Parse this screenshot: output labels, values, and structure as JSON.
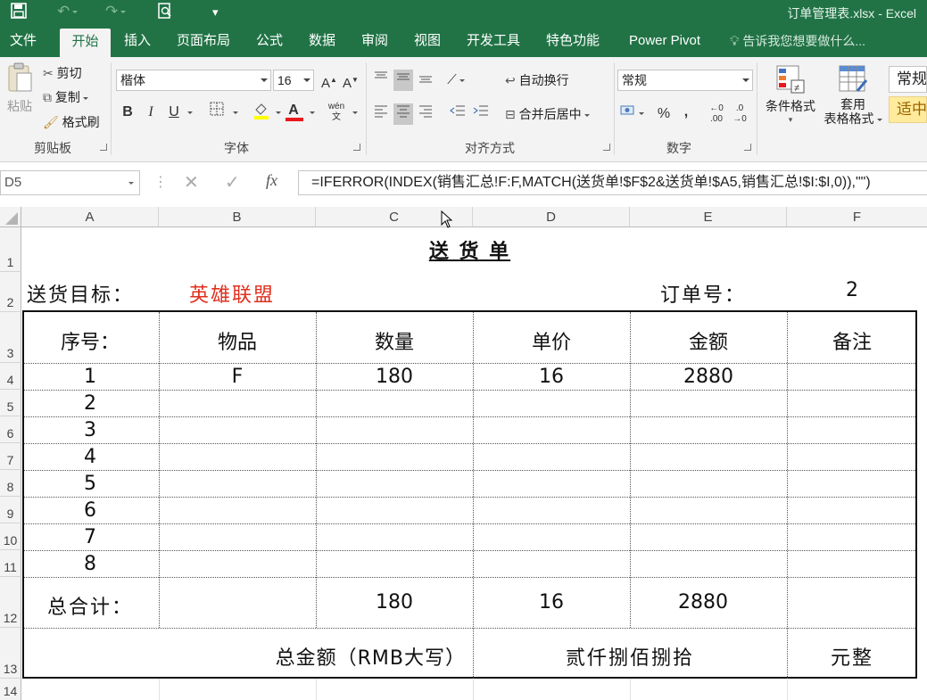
{
  "window": {
    "title": "订单管理表.xlsx - Excel",
    "theme_color": "#217346"
  },
  "quick_access": {
    "icons": [
      "save-icon",
      "undo-icon",
      "redo-icon",
      "print-preview-icon",
      "customize-icon"
    ]
  },
  "ribbon_tabs": [
    "文件",
    "开始",
    "插入",
    "页面布局",
    "公式",
    "数据",
    "审阅",
    "视图",
    "开发工具",
    "特色功能",
    "Power Pivot"
  ],
  "active_tab": "开始",
  "tell_me": "告诉我您想要做什么...",
  "clipboard": {
    "paste": "粘贴",
    "cut": "剪切",
    "copy": "复制",
    "format_painter": "格式刷",
    "label": "剪贴板"
  },
  "font": {
    "name": "楷体",
    "size": "16",
    "grow": "A",
    "shrink": "A",
    "bold": "B",
    "italic": "I",
    "underline": "U",
    "phonetic": "wén",
    "label": "字体"
  },
  "alignment": {
    "wrap_text": "自动换行",
    "merge_center": "合并后居中",
    "label": "对齐方式"
  },
  "number": {
    "format": "常规",
    "percent": "%",
    "comma": ",",
    "increase_decimal": ".00",
    "decrease_decimal": ".0",
    "label": "数字"
  },
  "styles": {
    "conditional_formatting": "条件格式",
    "format_as_table_line1": "套用",
    "format_as_table_line2": "表格格式",
    "style_normal": "常规",
    "style_neutral": "适中"
  },
  "formula_bar": {
    "name_box": "D5",
    "fx": "fx",
    "formula": "=IFERROR(INDEX(销售汇总!F:F,MATCH(送货单!$F$2&送货单!$A5,销售汇总!$I:$I,0)),\"\")"
  },
  "columns": [
    "A",
    "B",
    "C",
    "D",
    "E",
    "F"
  ],
  "rows": [
    "1",
    "2",
    "3",
    "4",
    "5",
    "6",
    "7",
    "8",
    "9",
    "10",
    "11",
    "12",
    "13",
    "14"
  ],
  "sheet": {
    "title": "送 货 单",
    "target_label": "送货目标：",
    "target_value": "英雄联盟",
    "target_color": "#e0301e",
    "order_label": "订单号：",
    "order_value": "2",
    "headers": [
      "序号：",
      "物品",
      "数量",
      "单价",
      "金额",
      "备注"
    ],
    "line_items": [
      {
        "no": "1",
        "item": "F",
        "qty": "180",
        "price": "16",
        "amount": "2880",
        "note": ""
      },
      {
        "no": "2",
        "item": "",
        "qty": "",
        "price": "",
        "amount": "",
        "note": ""
      },
      {
        "no": "3",
        "item": "",
        "qty": "",
        "price": "",
        "amount": "",
        "note": ""
      },
      {
        "no": "4",
        "item": "",
        "qty": "",
        "price": "",
        "amount": "",
        "note": ""
      },
      {
        "no": "5",
        "item": "",
        "qty": "",
        "price": "",
        "amount": "",
        "note": ""
      },
      {
        "no": "6",
        "item": "",
        "qty": "",
        "price": "",
        "amount": "",
        "note": ""
      },
      {
        "no": "7",
        "item": "",
        "qty": "",
        "price": "",
        "amount": "",
        "note": ""
      },
      {
        "no": "8",
        "item": "",
        "qty": "",
        "price": "",
        "amount": "",
        "note": ""
      }
    ],
    "total_label": "总合计：",
    "total_qty": "180",
    "total_price": "16",
    "total_amount": "2880",
    "rmb_label": "总金额（RMB大写）",
    "rmb_value": "贰仟捌佰捌拾",
    "rmb_suffix": "元整"
  }
}
